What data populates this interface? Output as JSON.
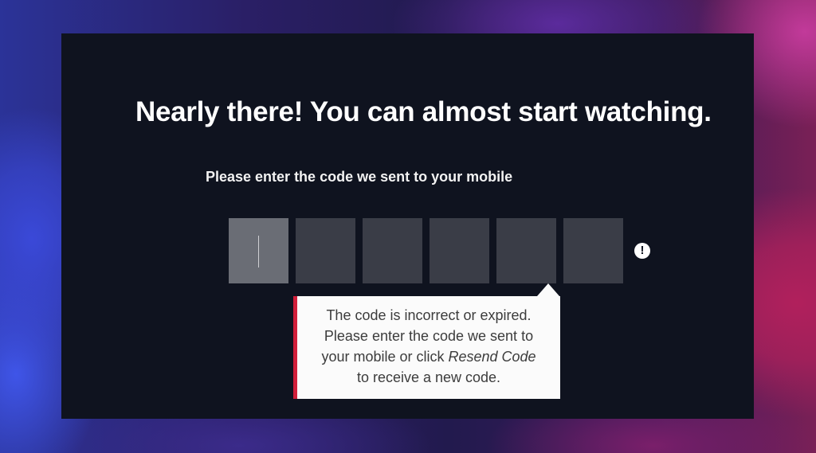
{
  "headline": "Nearly there! You can almost start watching.",
  "subtitle": "Please enter the code we sent to your mobile",
  "code_inputs": [
    {
      "value": "",
      "active": true
    },
    {
      "value": "",
      "active": false
    },
    {
      "value": "",
      "active": false
    },
    {
      "value": "",
      "active": false
    },
    {
      "value": "",
      "active": false
    },
    {
      "value": "",
      "active": false
    }
  ],
  "warning_icon": {
    "icon": "exclamation-circle-icon",
    "glyph": "!"
  },
  "error_tooltip": {
    "line1": "The code is incorrect or expired.",
    "line2": "Please enter the code we sent to",
    "line3_prefix": "your mobile or click ",
    "line3_link": "Resend Code",
    "line4": "to receive a new code."
  },
  "colors": {
    "modal_bg": "#0f131f",
    "input_bg": "#3a3d47",
    "input_active_bg": "#6a6d75",
    "error_accent": "#d11f3a",
    "tooltip_bg": "#fbfbfb"
  }
}
